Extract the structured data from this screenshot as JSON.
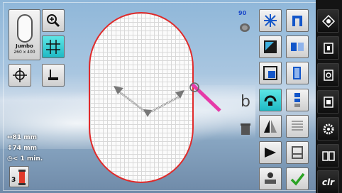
{
  "hoop": {
    "name": "Jumbo",
    "size": "260 x 400"
  },
  "info": {
    "width": "81 mm",
    "height": "74 mm",
    "time": "< 1 min."
  },
  "colors": {
    "count": "3",
    "hoop_outline": "#e02a2a",
    "active_button": "#1fb9c4"
  },
  "speed": {
    "value": "90"
  },
  "right_panel": {
    "clr_label": "clr"
  },
  "icons": [
    "zoom-in-icon",
    "grid-icon",
    "crosshair-icon",
    "presser-foot-icon",
    "hoop-icon",
    "sparkle-icon",
    "resize-icon",
    "duplicate-icon",
    "rotate-icon",
    "mirror-horizontal-icon",
    "mirror-vertical-icon",
    "thread-spool-icon",
    "stitch-counter-icon",
    "delete-icon",
    "move-icon",
    "checkmark-icon",
    "home-icon",
    "book-icon",
    "program-icon",
    "print-icon",
    "gear-icon",
    "split-screen-icon"
  ]
}
